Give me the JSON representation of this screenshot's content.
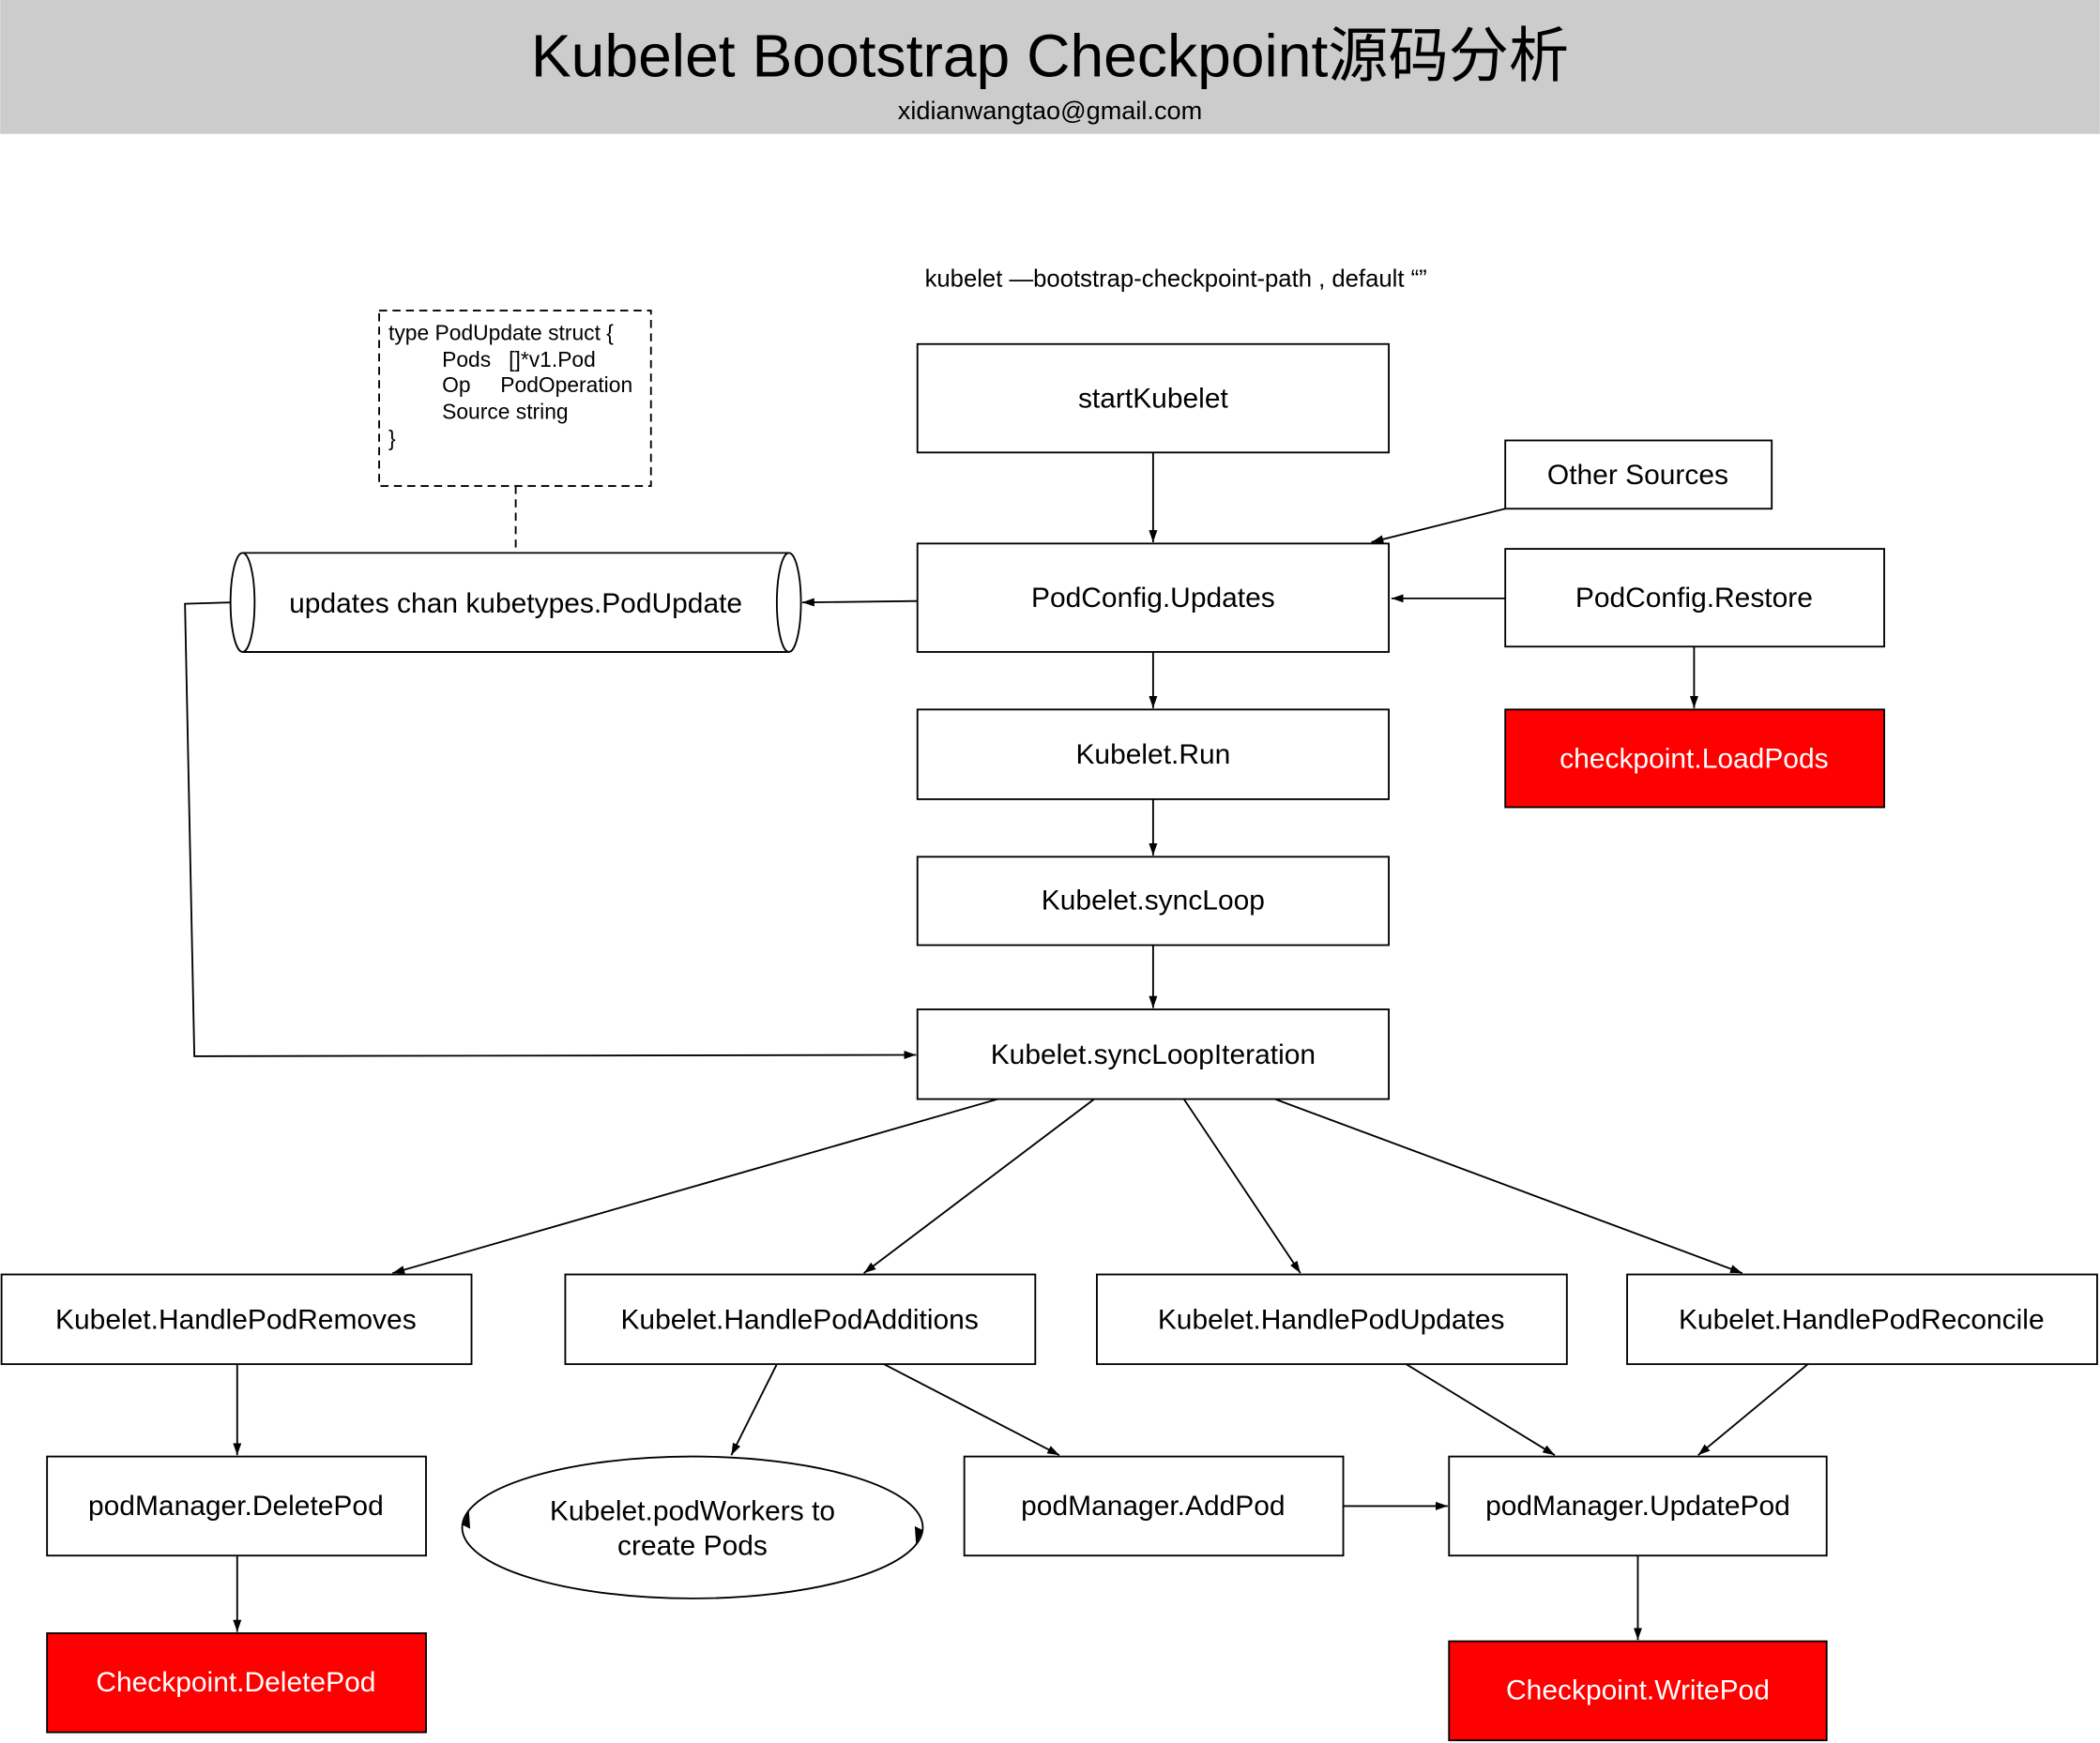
{
  "header": {
    "title": "Kubelet Bootstrap Checkpoint源码分析",
    "email": "xidianwangtao@gmail.com",
    "background_color": "#cccccc"
  },
  "subtitle": "kubelet —bootstrap-checkpoint-path , default “”",
  "struct_note": {
    "lines": [
      "type PodUpdate struct {",
      "Pods   []*v1.Pod",
      "Op     PodOperation",
      "Source string",
      "}"
    ]
  },
  "channel": {
    "label": "updates chan kubetypes.PodUpdate"
  },
  "nodes": {
    "start_kubelet": "startKubelet",
    "other_sources": "Other Sources",
    "pod_config_updates": "PodConfig.Updates",
    "pod_config_restore": "PodConfig.Restore",
    "checkpoint_load_pods": "checkpoint.LoadPods",
    "kubelet_run": "Kubelet.Run",
    "kubelet_sync_loop": "Kubelet.syncLoop",
    "kubelet_sync_loop_iteration": "Kubelet.syncLoopIteration",
    "handle_pod_removes": "Kubelet.HandlePodRemoves",
    "handle_pod_additions": "Kubelet.HandlePodAdditions",
    "handle_pod_updates": "Kubelet.HandlePodUpdates",
    "handle_pod_reconcile": "Kubelet.HandlePodReconcile",
    "pod_manager_delete_pod": "podManager.DeletePod",
    "checkpoint_delete_pod": "Checkpoint.DeletePod",
    "pod_workers_line1": "Kubelet.podWorkers to",
    "pod_workers_line2": "create Pods",
    "pod_manager_add_pod": "podManager.AddPod",
    "pod_manager_update_pod": "podManager.UpdatePod",
    "checkpoint_write_pod": "Checkpoint.WritePod"
  },
  "colors": {
    "highlight": "#ff0000",
    "highlight_text": "#ffffff"
  }
}
